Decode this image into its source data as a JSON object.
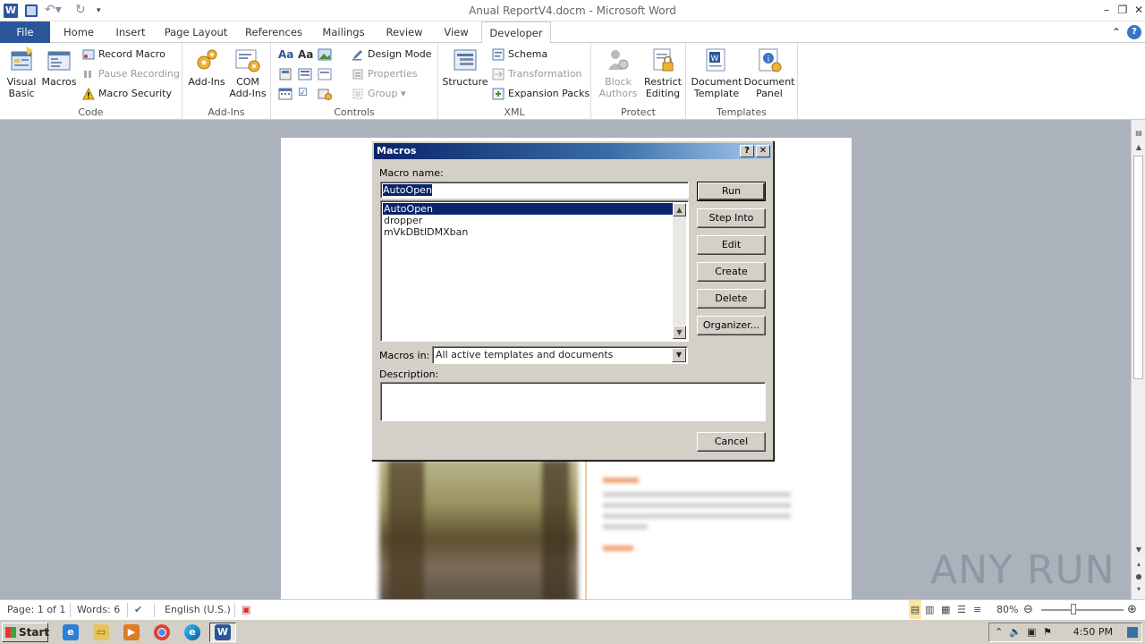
{
  "window": {
    "title": "Anual ReportV4.docm  -  Microsoft Word",
    "app_icon_letter": "W",
    "controls": {
      "minimize": "–",
      "restore": "❐",
      "close": "✕"
    }
  },
  "ribbon": {
    "tabs": [
      {
        "label": "File"
      },
      {
        "label": "Home"
      },
      {
        "label": "Insert"
      },
      {
        "label": "Page Layout"
      },
      {
        "label": "References"
      },
      {
        "label": "Mailings"
      },
      {
        "label": "Review"
      },
      {
        "label": "View"
      },
      {
        "label": "Developer"
      }
    ],
    "active_tab": "Developer",
    "groups": {
      "code": {
        "label": "Code",
        "visual_basic": "Visual Basic",
        "macros": "Macros",
        "record_macro": "Record Macro",
        "pause_recording": "Pause Recording",
        "macro_security": "Macro Security"
      },
      "addins": {
        "label": "Add-Ins",
        "addins": "Add-Ins",
        "com_addins": "COM Add-Ins"
      },
      "controls": {
        "label": "Controls",
        "design_mode": "Design Mode",
        "properties": "Properties",
        "group": "Group"
      },
      "xml": {
        "label": "XML",
        "structure": "Structure",
        "schema": "Schema",
        "transformation": "Transformation",
        "expansion_packs": "Expansion Packs"
      },
      "protect": {
        "label": "Protect",
        "block_authors": "Block Authors",
        "restrict_editing": "Restrict Editing"
      },
      "templates": {
        "label": "Templates",
        "document_template": "Document Template",
        "document_panel": "Document Panel"
      }
    }
  },
  "dialog": {
    "title": "Macros",
    "help_button": "?",
    "close_button": "✕",
    "macro_name_label": "Macro name:",
    "macro_name_value": "AutoOpen",
    "macro_list": [
      "AutoOpen",
      "dropper",
      "mVkDBtIDMXban"
    ],
    "selected_index": 0,
    "buttons": {
      "run": "Run",
      "step_into": "Step Into",
      "edit": "Edit",
      "create": "Create",
      "delete": "Delete",
      "organizer": "Organizer...",
      "cancel": "Cancel"
    },
    "macros_in_label": "Macros in:",
    "macros_in_value": "All active templates and documents",
    "description_label": "Description:",
    "description_value": ""
  },
  "status_bar": {
    "page": "Page: 1 of 1",
    "words": "Words: 6",
    "language": "English (U.S.)",
    "zoom": "80%",
    "zoom_level_fraction": 0.8
  },
  "taskbar": {
    "start_label": "Start",
    "clock": "4:50 PM",
    "apps": [
      "internet-explorer-icon",
      "folder-icon",
      "media-player-icon",
      "chrome-icon",
      "edge-icon",
      "word-icon"
    ]
  },
  "watermark": "ANY RUN"
}
